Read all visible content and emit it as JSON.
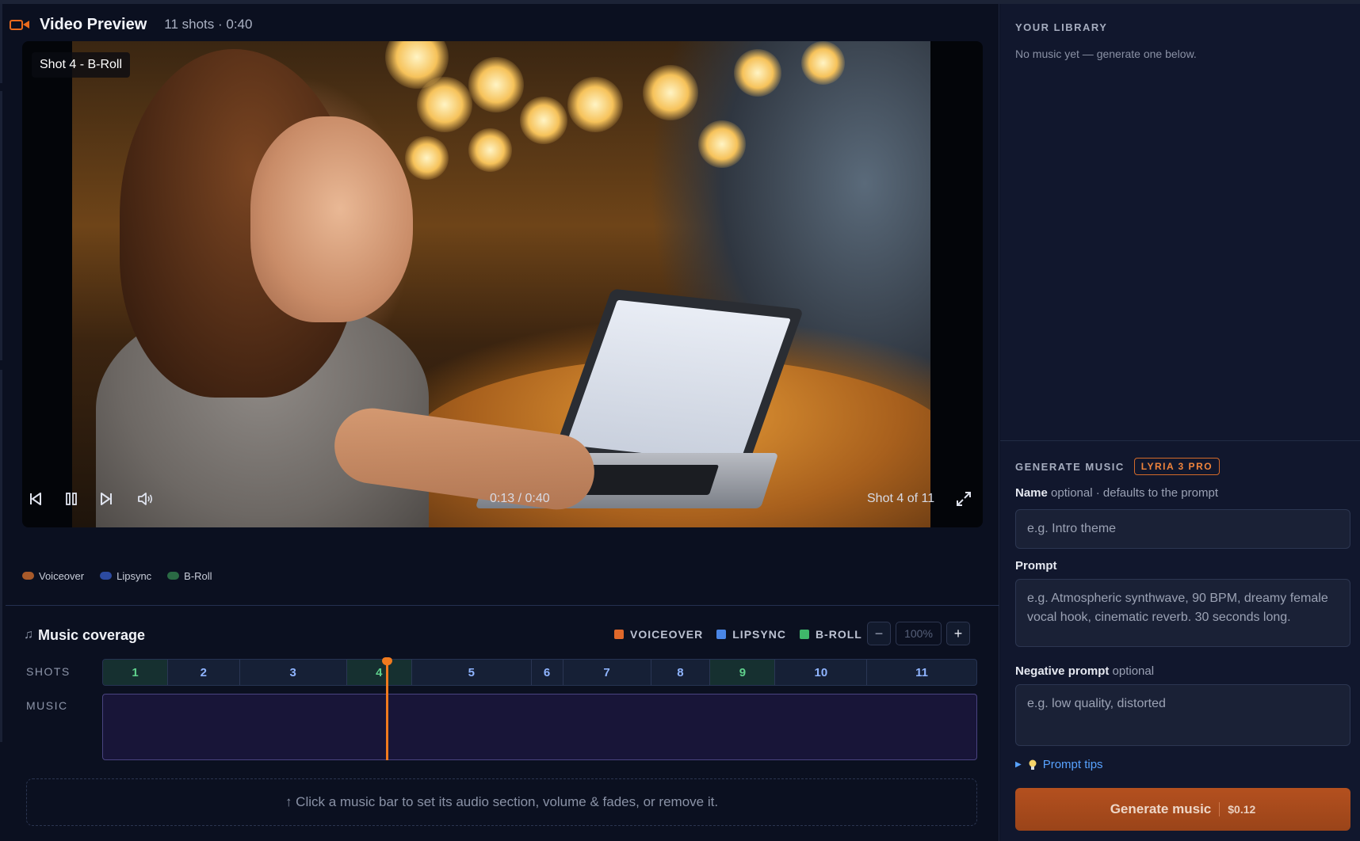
{
  "header": {
    "title": "Video Preview",
    "meta": "11 shots · 0:40"
  },
  "player": {
    "shot_label": "Shot 4 - B-Roll",
    "time": "0:13 / 0:40",
    "shot_of": "Shot 4 of 11"
  },
  "clip_legend": [
    {
      "label": "Voiceover",
      "color": "#a85a2a"
    },
    {
      "label": "Lipsync",
      "color": "#2c4aa0"
    },
    {
      "label": "B-Roll",
      "color": "#2a6a44"
    }
  ],
  "music_coverage": {
    "title": "Music coverage",
    "note_icon": "music-note-icon",
    "legend": [
      {
        "label": "VOICEOVER",
        "color": "#e0682a"
      },
      {
        "label": "LIPSYNC",
        "color": "#4a86e6"
      },
      {
        "label": "B-ROLL",
        "color": "#3fb76a"
      }
    ],
    "zoom": {
      "minus": "−",
      "value": "100%",
      "plus": "+"
    },
    "shots_label": "SHOTS",
    "music_label": "MUSIC",
    "shots": [
      {
        "label": "1",
        "type": "b-roll",
        "share": 6.8
      },
      {
        "label": "2",
        "type": "lipsync",
        "share": 7.5
      },
      {
        "label": "3",
        "type": "lipsync",
        "share": 11.2
      },
      {
        "label": "4",
        "type": "b-roll",
        "share": 6.8
      },
      {
        "label": "5",
        "type": "lipsync",
        "share": 12.5
      },
      {
        "label": "6",
        "type": "lipsync",
        "share": 3.3
      },
      {
        "label": "7",
        "type": "lipsync",
        "share": 9.2
      },
      {
        "label": "8",
        "type": "lipsync",
        "share": 6.2
      },
      {
        "label": "9",
        "type": "b-roll",
        "share": 6.8
      },
      {
        "label": "10",
        "type": "lipsync",
        "share": 9.6
      },
      {
        "label": "11",
        "type": "lipsync",
        "share": 11.4
      }
    ],
    "playhead_progress": 0.325,
    "hint": "↑ Click a music bar to set its audio section, volume & fades, or remove it."
  },
  "library": {
    "title": "YOUR LIBRARY",
    "empty": "No music yet — generate one below."
  },
  "generate": {
    "title": "GENERATE MUSIC",
    "model_badge": "LYRIA 3 PRO",
    "name_label": "Name",
    "name_hint": "optional · defaults to the prompt",
    "name_placeholder": "e.g. Intro theme",
    "prompt_label": "Prompt",
    "prompt_placeholder": "e.g. Atmospheric synthwave, 90 BPM, dreamy female vocal hook, cinematic reverb. 30 seconds long.",
    "neg_label": "Negative prompt",
    "neg_hint": "optional",
    "neg_placeholder": "e.g. low quality, distorted",
    "tips": "Prompt tips",
    "button_label": "Generate music",
    "button_price": "$0.12"
  }
}
